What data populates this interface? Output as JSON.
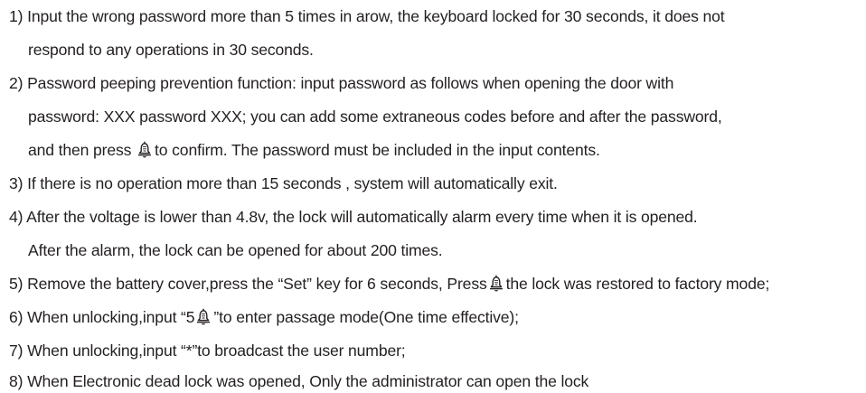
{
  "items": [
    {
      "number": "1)",
      "lines": [
        "Input the wrong password more than 5 times in arow, the keyboard locked for 30 seconds, it does not",
        "respond to any operations in 30 seconds."
      ]
    },
    {
      "number": "2)",
      "lines": [
        "Password peeping prevention function: input password as follows when opening the door with",
        "password: XXX password XXX; you can add some extraneous codes before and after the password,"
      ],
      "line3_before": "and then press",
      "line3_after": "to confirm. The password must be included in the input contents."
    },
    {
      "number": "3)",
      "text": "If there is no operation more than 15 seconds , system will automatically exit."
    },
    {
      "number": "4)",
      "lines": [
        "After the voltage is lower than 4.8v, the lock will automatically alarm every time when it is opened.",
        "After the alarm, the lock can be opened for about 200 times."
      ]
    },
    {
      "number": "5)",
      "before": "Remove the battery cover,press the “Set” key for 6 seconds, Press",
      "after": "the lock was restored to factory mode;"
    },
    {
      "number": "6)",
      "before": "When unlocking,input “5",
      "after": "”to enter passage mode(One time effective);"
    },
    {
      "number": "7)",
      "text": "When unlocking,input “*”to broadcast the user number;"
    },
    {
      "number": "8)",
      "text": "When Electronic dead lock was opened, Only the administrator can open the lock"
    }
  ],
  "icons": {
    "confirm_key": "bell-key-icon"
  },
  "colors": {
    "text": "#231f20",
    "background": "#ffffff"
  }
}
